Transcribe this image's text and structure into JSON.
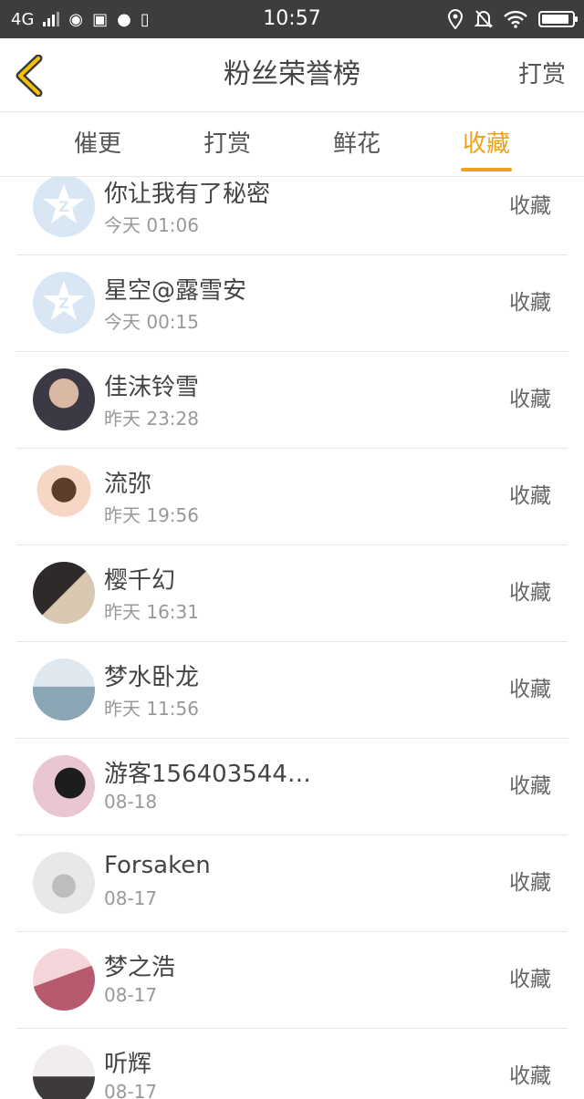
{
  "status_bar": {
    "network": "4G",
    "time": "10:57"
  },
  "header": {
    "title": "粉丝荣誉榜",
    "right_action": "打赏"
  },
  "tabs": [
    {
      "label": "催更",
      "active": false
    },
    {
      "label": "打赏",
      "active": false
    },
    {
      "label": "鲜花",
      "active": false
    },
    {
      "label": "收藏",
      "active": true
    }
  ],
  "rows": [
    {
      "name": "你让我有了秘密",
      "time": "今天 01:06",
      "action": "收藏"
    },
    {
      "name": "星空@露雪安",
      "time": "今天 00:15",
      "action": "收藏"
    },
    {
      "name": "佳沫铃雪",
      "time": "昨天 23:28",
      "action": "收藏"
    },
    {
      "name": "流弥",
      "time": "昨天 19:56",
      "action": "收藏"
    },
    {
      "name": "樱千幻",
      "time": "昨天 16:31",
      "action": "收藏"
    },
    {
      "name": "梦水卧龙",
      "time": "昨天 11:56",
      "action": "收藏"
    },
    {
      "name": "游客156403544…",
      "time": "08-18",
      "action": "收藏"
    },
    {
      "name": "Forsaken",
      "time": "08-17",
      "action": "收藏"
    },
    {
      "name": "梦之浩",
      "time": "08-17",
      "action": "收藏"
    },
    {
      "name": "听辉",
      "time": "08-17",
      "action": "收藏"
    }
  ],
  "colors": {
    "accent": "#f0a21a",
    "status_bar_bg": "#3d3d3d"
  }
}
